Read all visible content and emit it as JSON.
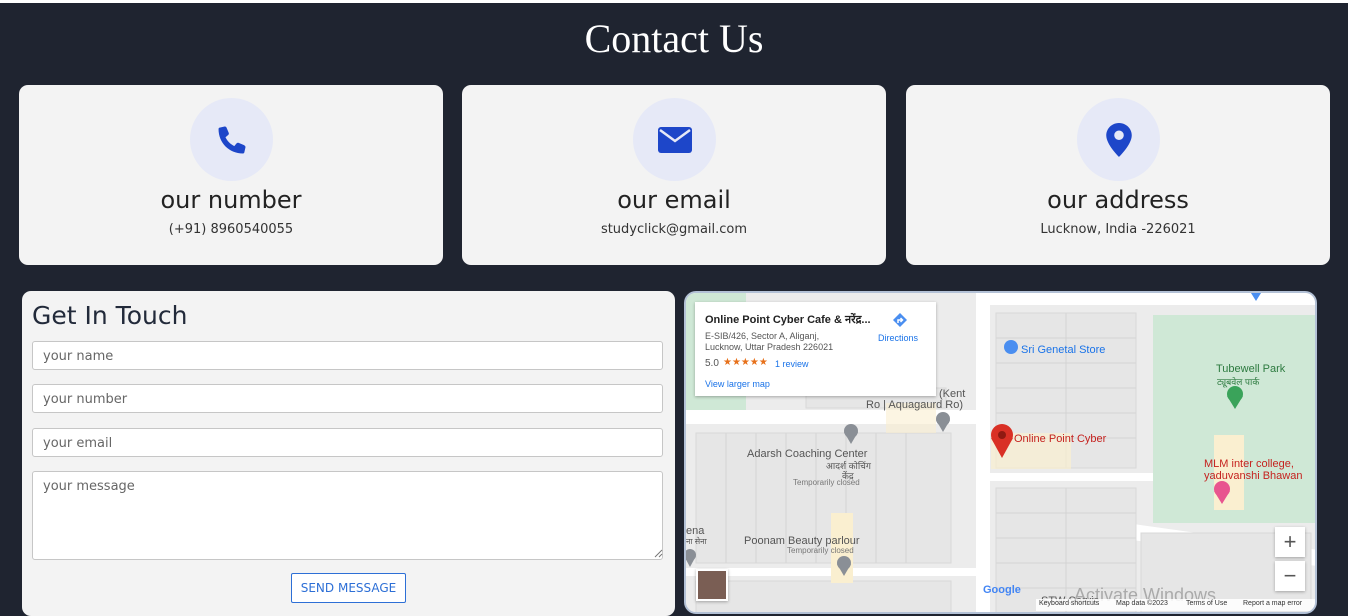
{
  "page_title": "Contact Us",
  "cards": [
    {
      "title": "our number",
      "value": "(+91) 8960540055",
      "icon": "phone-icon"
    },
    {
      "title": "our email",
      "value": "studyclick@gmail.com",
      "icon": "envelope-icon"
    },
    {
      "title": "our address",
      "value": "Lucknow, India -226021",
      "icon": "map-pin-icon"
    }
  ],
  "form": {
    "title": "Get In Touch",
    "name_placeholder": "your name",
    "number_placeholder": "your number",
    "email_placeholder": "your email",
    "message_placeholder": "your message",
    "submit_label": "SEND MESSAGE"
  },
  "map": {
    "place_name": "Online Point Cyber Cafe & नरेंद्र...",
    "address_line1": "E-SIB/426, Sector A, Aliganj,",
    "address_line2": "Lucknow, Uttar Pradesh 226021",
    "rating": "5.0",
    "stars": "★★★★★",
    "reviews": "1 review",
    "directions": "Directions",
    "larger_map": "View larger map",
    "labels": {
      "sri": "Sri Genetal Store",
      "kent1": "(Kent",
      "kent2": "Ro | Aquagaurd Ro)",
      "tubewell": "Tubewell Park",
      "tubewell_hi": "ट्यूबवेल पार्क",
      "cyber": "Online Point Cyber",
      "adarsh": "Adarsh Coaching Center",
      "adarsh_hi1": "आदर्श कोचिंग",
      "adarsh_hi2": "केंद्र",
      "adarsh_closed": "Temporarily closed",
      "mlm1": "MLM inter college,",
      "mlm2": "yaduvanshi Bhawan",
      "poonam": "Poonam Beauty parlour",
      "poonam_closed": "Temporarily closed",
      "ena": "ena",
      "ena_hi": "ना सेना",
      "stw": "STW Servic"
    },
    "google": "Google",
    "footer": {
      "shortcuts": "Keyboard shortcuts",
      "mapdata": "Map data ©2023",
      "terms": "Terms of Use",
      "report": "Report a map error"
    },
    "watermark": "Activate Windows",
    "zoom_in": "+",
    "zoom_out": "−"
  },
  "colors": {
    "background": "#1f2430",
    "card": "#f3f3f3",
    "accent": "#1d46c9",
    "icon_circle": "#e6e9f7",
    "button": "#2d6fd6"
  }
}
